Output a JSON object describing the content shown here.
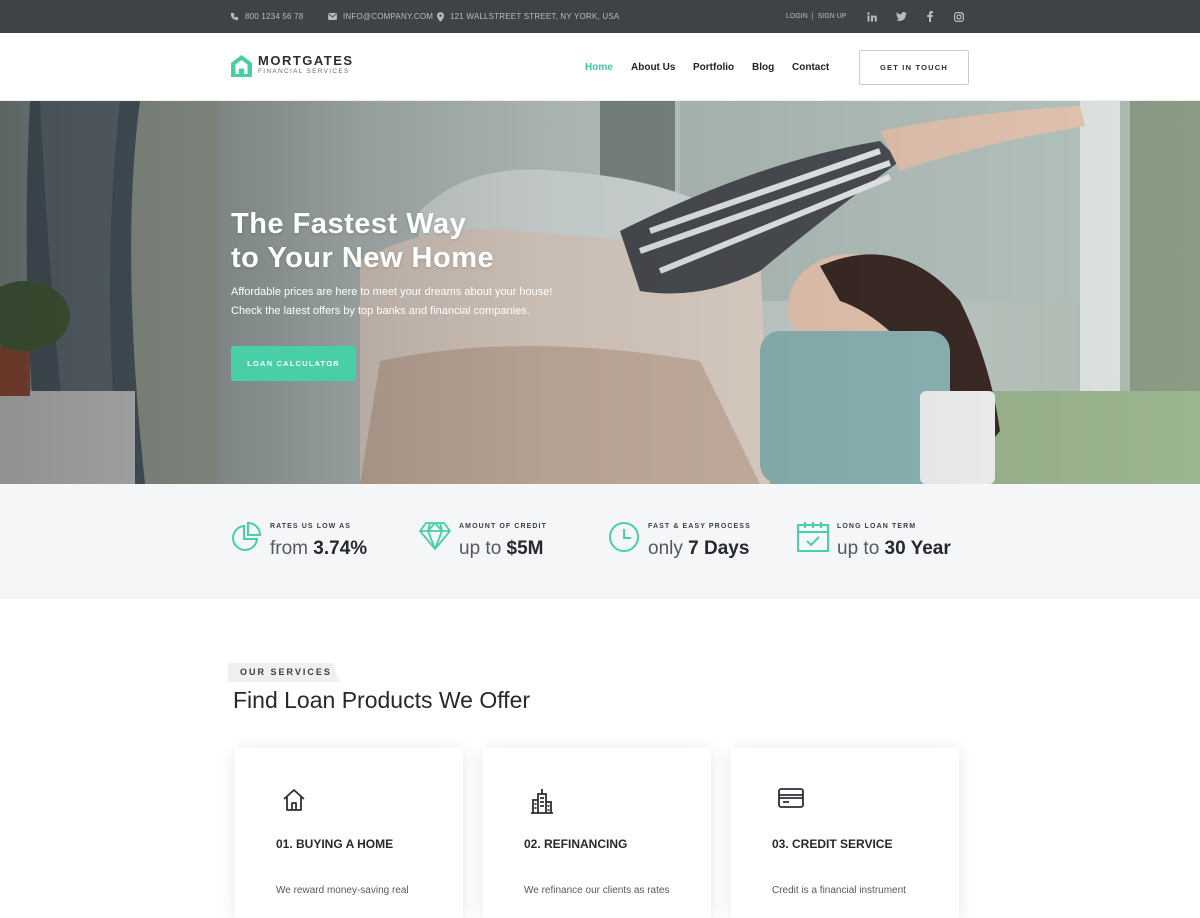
{
  "topbar": {
    "phone": "800 1234 56 78",
    "email": "INFO@COMPANY.COM",
    "address": "121 WALLSTREET STREET, NY YORK, USA",
    "login": "LOGIN",
    "separator": "|",
    "signup": "SIGN UP",
    "social": [
      "linkedin-icon",
      "twitter-icon",
      "facebook-icon",
      "instagram-icon"
    ]
  },
  "header": {
    "brand": "MORTGATES",
    "tagline": "FINANCIAL SERVICES",
    "nav": [
      "Home",
      "About Us",
      "Portfolio",
      "Blog",
      "Contact"
    ],
    "active_nav": "Home",
    "cta": "GET IN TOUCH"
  },
  "hero": {
    "title_line1": "The Fastest Way",
    "title_line2": "to Your New Home",
    "text_line1": "Affordable prices are here to meet your dreams about your house!",
    "text_line2": "Check the latest offers by top banks and financial companies.",
    "button": "LOAN CALCULATOR"
  },
  "stats": [
    {
      "icon": "pie-chart-icon",
      "label": "RATES US LOW AS",
      "prefix": "from",
      "value": "3.74%"
    },
    {
      "icon": "diamond-icon",
      "label": "AMOUNT OF CREDIT",
      "prefix": "up to",
      "value": "$5M"
    },
    {
      "icon": "clock-icon",
      "label": "FAST & EASY PROCESS",
      "prefix": "only",
      "value": "7 Days"
    },
    {
      "icon": "calendar-check-icon",
      "label": "LONG LOAN TERM",
      "prefix": "up to",
      "value": "30 Year"
    }
  ],
  "services": {
    "badge": "OUR SERVICES",
    "title": "Find Loan Products We Offer",
    "cards": [
      {
        "icon": "house-icon",
        "title": "01. BUYING A HOME",
        "text": "We reward money-saving real"
      },
      {
        "icon": "buildings-icon",
        "title": "02. REFINANCING",
        "text": "We refinance our clients as rates"
      },
      {
        "icon": "credit-card-icon",
        "title": "03. CREDIT SERVICE",
        "text": "Credit is a financial instrument"
      }
    ]
  },
  "colors": {
    "accent": "#48cfa7",
    "topbar": "#3f4346",
    "stats_bg": "#f4f6f8"
  }
}
